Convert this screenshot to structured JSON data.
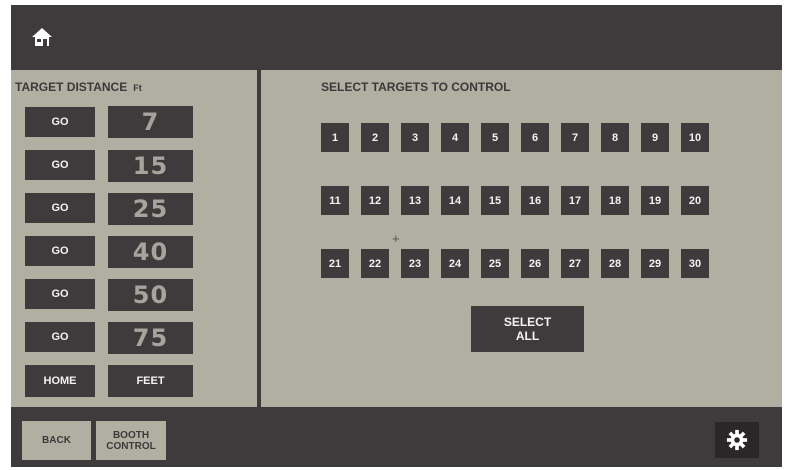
{
  "header": {
    "home_icon": "home-icon"
  },
  "distance_panel": {
    "title": "TARGET DISTANCE",
    "unit": "Ft",
    "rows": [
      {
        "go_label": "GO",
        "distance": "7"
      },
      {
        "go_label": "GO",
        "distance": "15"
      },
      {
        "go_label": "GO",
        "distance": "25"
      },
      {
        "go_label": "GO",
        "distance": "40"
      },
      {
        "go_label": "GO",
        "distance": "50"
      },
      {
        "go_label": "GO",
        "distance": "75"
      }
    ],
    "home_label": "HOME",
    "feet_label": "FEET"
  },
  "targets_panel": {
    "title": "SELECT TARGETS TO CONTROL",
    "targets": [
      "1",
      "2",
      "3",
      "4",
      "5",
      "6",
      "7",
      "8",
      "9",
      "10",
      "11",
      "12",
      "13",
      "14",
      "15",
      "16",
      "17",
      "18",
      "19",
      "20",
      "21",
      "22",
      "23",
      "24",
      "25",
      "26",
      "27",
      "28",
      "29",
      "30"
    ],
    "select_all_line1": "SELECT",
    "select_all_line2": "ALL"
  },
  "footer": {
    "back_label": "BACK",
    "booth_line1": "BOOTH",
    "booth_line2": "CONTROL",
    "settings_icon": "gear-icon"
  },
  "colors": {
    "frame": "#3f3b3d",
    "panel": "#b1aea2",
    "button": "#3f3b3d",
    "button_text": "#f2f2f2",
    "distance_text": "#a6a49d"
  }
}
